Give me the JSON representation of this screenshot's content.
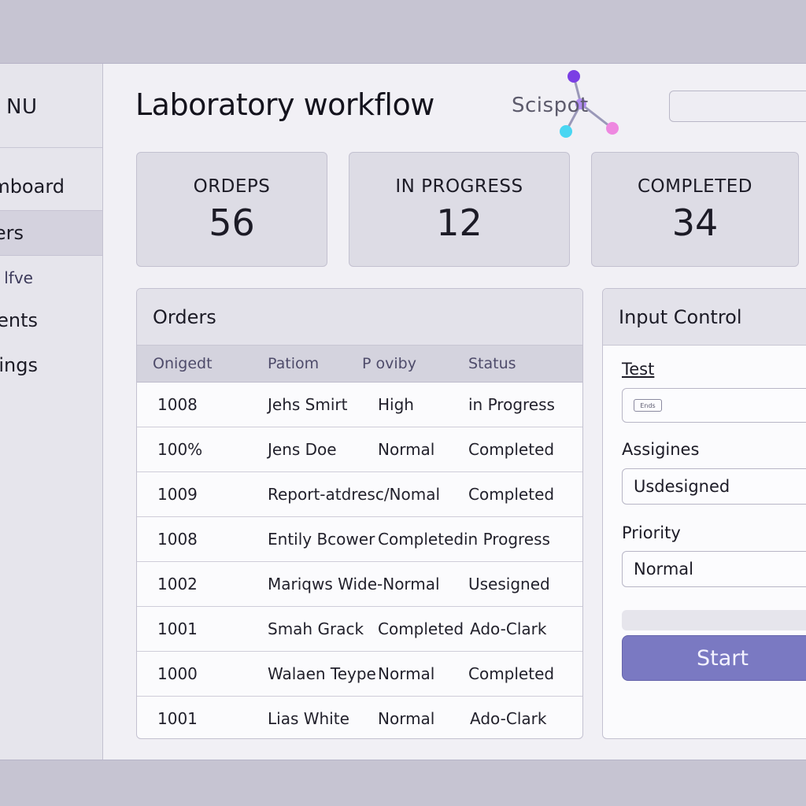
{
  "sidebar": {
    "brand": "NU",
    "items": [
      {
        "label": "mboard",
        "active": false
      },
      {
        "label": "ers",
        "active": true
      },
      {
        "label": "lfve",
        "active": false
      },
      {
        "label": "ents",
        "active": false
      },
      {
        "label": "ings",
        "active": false
      }
    ]
  },
  "header": {
    "title": "Laboratory workflow",
    "logo_text": "Scispot"
  },
  "stats": [
    {
      "label": "ORDEPS",
      "value": "56"
    },
    {
      "label": "IN PROGRESS",
      "value": "12"
    },
    {
      "label": "COMPLETED",
      "value": "34"
    }
  ],
  "orders": {
    "title": "Orders",
    "columns": [
      "Onigedt",
      "Patiom",
      "P oviby",
      "Status"
    ],
    "rows": [
      [
        "1008",
        "Jehs Smirt",
        "High",
        "in Progress"
      ],
      [
        "100%",
        "Jens Doe",
        "Normal",
        "Completed"
      ],
      [
        "1009",
        "Report-atdresc/Nomal",
        "",
        "Completed"
      ],
      [
        "1008",
        "Entily Bcower",
        "Completed",
        "in Progress"
      ],
      [
        "1002",
        "Mariqws Wide-Normal",
        "",
        "Usesigned"
      ],
      [
        "1001",
        "Smah Grack",
        "Completed",
        "Ado-Clark"
      ],
      [
        "1000",
        "Walaen Teype",
        "Normal",
        "Completed"
      ],
      [
        "1001",
        "Lias White",
        "Normal",
        "Ado-Clark"
      ]
    ]
  },
  "input_control": {
    "title": "Input Control",
    "test_label": "Test",
    "test_chip": "Ends",
    "assignee_label": "Assigines",
    "assignee_value": "Usdesigned",
    "priority_label": "Priority",
    "priority_value": "Normal",
    "start_label": "Start"
  },
  "colors": {
    "accent": "#7a79c2",
    "logo_purple": "#7b3fe4",
    "logo_cyan": "#49d6f2",
    "logo_pink": "#ee88e0"
  }
}
